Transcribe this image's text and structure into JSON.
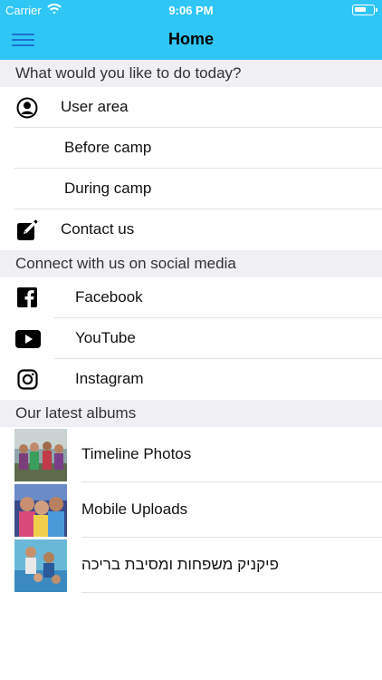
{
  "status_bar": {
    "carrier": "Carrier",
    "time": "9:06 PM"
  },
  "nav": {
    "title": "Home",
    "menu_icon": "hamburger-menu-icon"
  },
  "sections": {
    "todo": {
      "header": "What would you like to do today?",
      "items": [
        {
          "label": "User area",
          "icon": "user-circle-icon"
        },
        {
          "label": "Before camp"
        },
        {
          "label": "During camp"
        },
        {
          "label": "Contact us",
          "icon": "compose-icon"
        }
      ]
    },
    "social": {
      "header": "Connect with us on social media",
      "items": [
        {
          "label": "Facebook",
          "icon": "facebook-icon"
        },
        {
          "label": "YouTube",
          "icon": "youtube-icon"
        },
        {
          "label": "Instagram",
          "icon": "instagram-icon"
        }
      ]
    },
    "albums": {
      "header": "Our latest albums",
      "items": [
        {
          "label": "Timeline Photos"
        },
        {
          "label": "Mobile Uploads"
        },
        {
          "label": "פיקניק משפחות ומסיבת בריכה"
        }
      ]
    }
  },
  "colors": {
    "nav_background": "#2fc6f6",
    "menu_icon": "#1b6fcf",
    "section_background": "#efeff4"
  }
}
